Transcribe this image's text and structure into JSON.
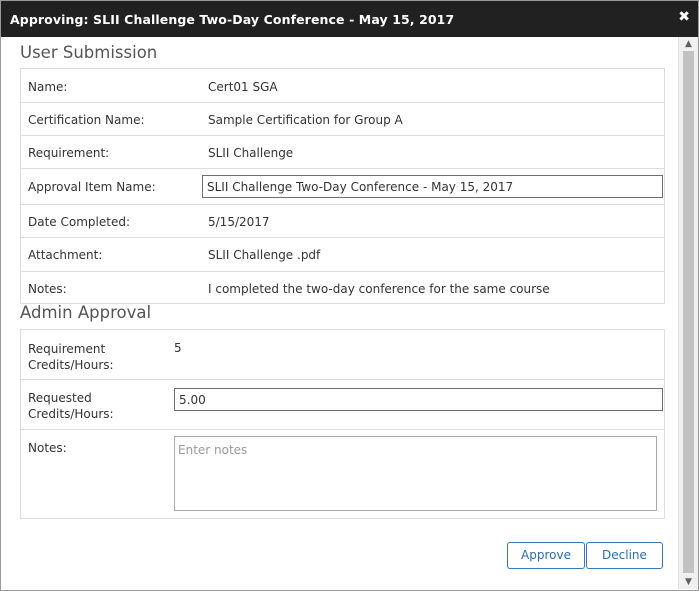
{
  "dialog": {
    "title": "Approving: SLII Challenge Two-Day Conference - May 15, 2017",
    "close_glyph": "✖"
  },
  "user_submission": {
    "heading": "User Submission",
    "name_label": "Name:",
    "name_value": "Cert01 SGA",
    "certification_label": "Certification Name:",
    "certification_value": "Sample Certification for Group A",
    "requirement_label": "Requirement:",
    "requirement_value": "SLII Challenge",
    "approval_item_label": "Approval Item Name:",
    "approval_item_value": "SLII Challenge Two-Day Conference - May 15, 2017",
    "date_label": "Date Completed:",
    "date_value": "5/15/2017",
    "attachment_label": "Attachment:",
    "attachment_value": "SLII Challenge .pdf",
    "notes_label": "Notes:",
    "notes_value": "I completed the two-day conference for the same course"
  },
  "admin_approval": {
    "heading": "Admin Approval",
    "req_credits_label_1": "Requirement",
    "req_credits_label_2": "Credits/Hours:",
    "req_credits_value": "5",
    "requested_credits_label_1": "Requested",
    "requested_credits_label_2": "Credits/Hours:",
    "requested_credits_value": "5.00",
    "notes_label": "Notes:",
    "notes_placeholder": "Enter notes"
  },
  "buttons": {
    "approve": "Approve",
    "decline": "Decline"
  },
  "scrollbar": {
    "up_glyph": "▲",
    "down_glyph": "▼"
  },
  "colors": {
    "titlebar_bg": "#212121",
    "accent": "#2b6cb0",
    "border": "#dddddd"
  }
}
